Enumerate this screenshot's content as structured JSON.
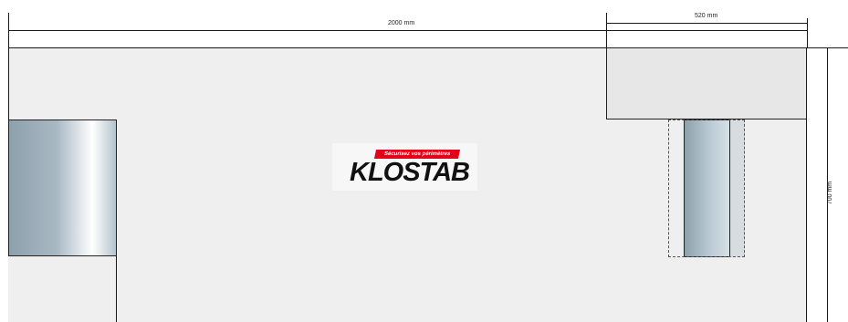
{
  "dimensions": {
    "width_label": "2000 mm",
    "post_width_label": "520 mm",
    "height_label": "700 mm"
  },
  "logo": {
    "tagline": "Sécurisez vos périmètres",
    "brand": "KLOSTAB",
    "accent_color": "#e3001b"
  }
}
